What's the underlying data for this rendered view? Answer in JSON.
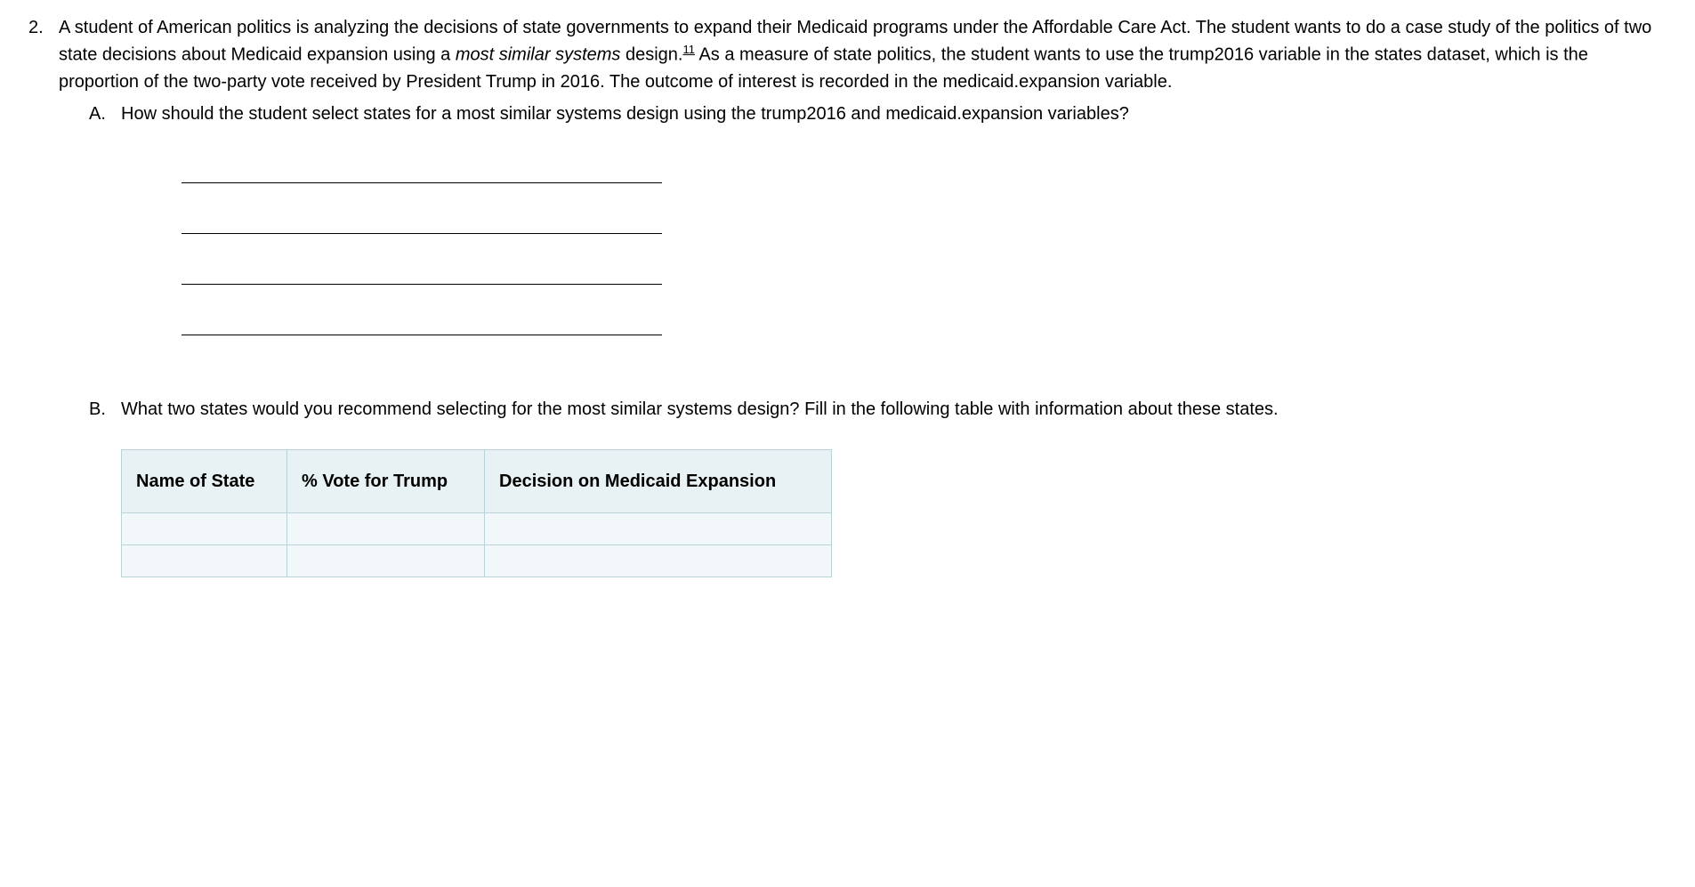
{
  "question": {
    "number": "2.",
    "text_part1": "A student of American politics is analyzing the decisions of state governments to expand their Medicaid programs under the Affordable Care Act. The student wants to do a case study of the politics of two state decisions about Medicaid expansion using a ",
    "italic_phrase": "most similar systems",
    "text_part2": " design.",
    "footnote": "11",
    "text_part3": " As a measure of state politics, the student wants to use the trump2016 variable in the states dataset, which is the proportion of the two-party vote received by President Trump in 2016. The outcome of interest is recorded in the medicaid.expansion variable."
  },
  "subA": {
    "letter": "A.",
    "text": "How should the student select states for a most similar systems design using the trump2016 and medicaid.expansion variables?"
  },
  "subB": {
    "letter": "B.",
    "text": "What two states would you recommend selecting for the most similar systems design? Fill in the following table with information about these states."
  },
  "table": {
    "headers": {
      "col1": "Name of State",
      "col2": "% Vote for Trump",
      "col3": "Decision on Medicaid Expansion"
    },
    "rows": [
      {
        "col1": "",
        "col2": "",
        "col3": ""
      },
      {
        "col1": "",
        "col2": "",
        "col3": ""
      }
    ]
  }
}
